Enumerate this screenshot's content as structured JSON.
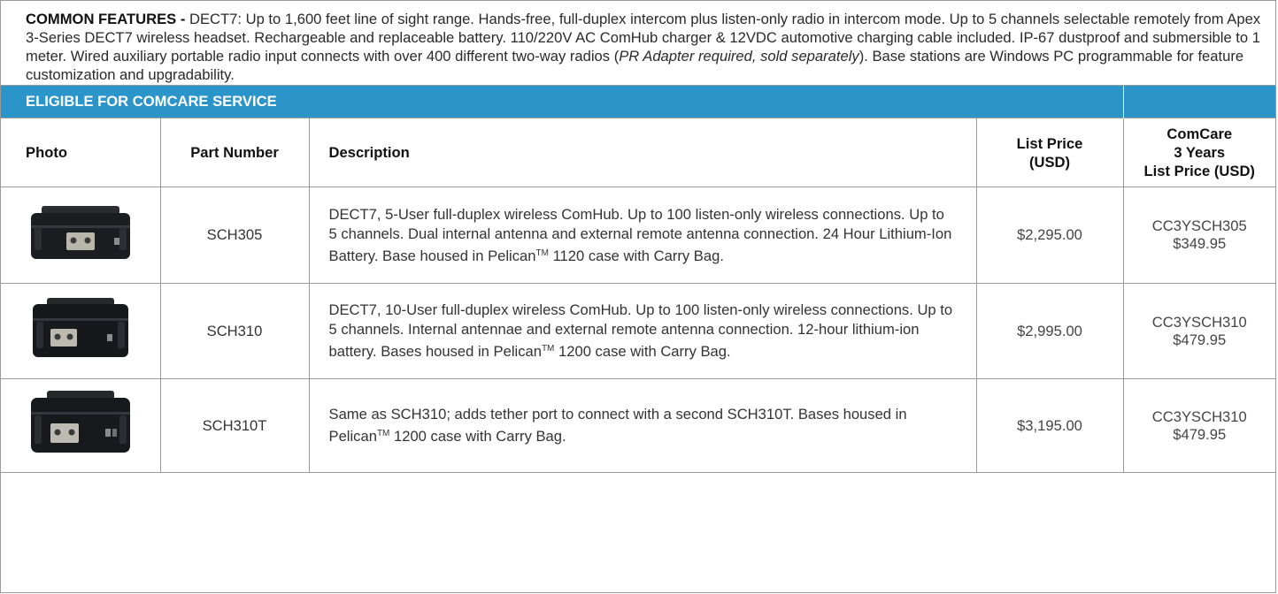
{
  "features": {
    "heading": "COMMON FEATURES -",
    "text_before_italic": " DECT7: Up to 1,600 feet line of sight range. Hands-free, full-duplex intercom plus listen-only radio in intercom mode. Up to 5 channels selectable remotely from Apex 3-Series DECT7 wireless headset. Rechargeable and replaceable battery. 110/220V AC ComHub charger & 12VDC automotive charging cable included. IP-67 dustproof and submersible to 1 meter. Wired auxiliary portable radio input connects with over 400 different two-way radios (",
    "italic": "PR Adapter required, sold separately",
    "text_after_italic": "). Base stations are Windows PC programmable for feature customization and upgradability."
  },
  "banner": {
    "label": "ELIGIBLE FOR COMCARE SERVICE"
  },
  "headers": {
    "photo": "Photo",
    "part_number": "Part Number",
    "description": "Description",
    "list_price_line1": "List Price",
    "list_price_line2": "(USD)",
    "comcare_line1": "ComCare",
    "comcare_line2": "3 Years",
    "comcare_line3": "List Price (USD)"
  },
  "trademark": "TM",
  "rows": [
    {
      "part": "SCH305",
      "desc_before_tm": "DECT7, 5-User full-duplex wireless ComHub. Up to 100 listen-only wireless connections. Up to 5 channels. Dual internal antenna and external remote antenna connection. 24 Hour Lithium-Ion Battery. Base housed in Pelican",
      "desc_after_tm": " 1120 case with Carry Bag.",
      "price": "$2,295.00",
      "cc_code": "CC3YSCH305",
      "cc_price": "$349.95"
    },
    {
      "part": "SCH310",
      "desc_before_tm": "DECT7, 10-User full-duplex wireless ComHub. Up to 100 listen-only wireless connections. Up to 5 channels. Internal antennae and external remote antenna connection. 12-hour lithium-ion battery. Bases housed in Pelican",
      "desc_after_tm": " 1200 case with Carry Bag.",
      "price": "$2,995.00",
      "cc_code": "CC3YSCH310",
      "cc_price": "$479.95"
    },
    {
      "part": "SCH310T",
      "desc_before_tm": "Same as SCH310; adds tether port to connect with a second SCH310T. Bases housed in Pelican",
      "desc_after_tm": " 1200 case with Carry Bag.",
      "price": "$3,195.00",
      "cc_code": "CC3YSCH310",
      "cc_price": "$479.95"
    }
  ]
}
